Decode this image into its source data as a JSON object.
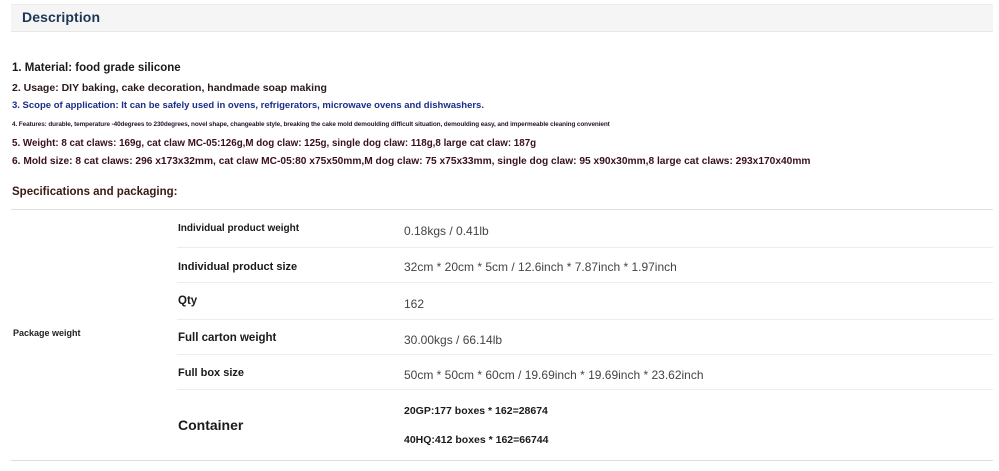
{
  "description": {
    "title": "Description"
  },
  "details": {
    "material": "1. Material: food grade silicone",
    "usage": "2. Usage: DIY baking, cake decoration, handmade soap making",
    "scope": "3. Scope of application: It can be safely used in ovens, refrigerators, microwave ovens and dishwashers.",
    "features": "4. Features: durable, temperature -40degrees to 230degrees, novel shape, changeable style, breaking the cake mold demoulding difficult situation, demoulding easy, and impermeable cleaning convenient",
    "weight": "5. Weight: 8 cat claws: 169g, cat claw MC-05:126g,M dog claw: 125g, single dog claw: 118g,8 large cat claw: 187g",
    "mold_size": "6. Mold size: 8 cat claws: 296 x173x32mm, cat claw MC-05:80 x75x50mm,M dog claw: 75 x75x33mm, single dog claw: 95 x90x30mm,8 large cat claws: 293x170x40mm"
  },
  "specs": {
    "heading": "Specifications and packaging:",
    "group_label": "Package weight",
    "rows": [
      {
        "label": "Individual product weight",
        "value": "0.18kgs / 0.41lb"
      },
      {
        "label": "Individual product size",
        "value": "32cm * 20cm * 5cm / 12.6inch * 7.87inch * 1.97inch"
      },
      {
        "label": "Qty",
        "value": "162"
      },
      {
        "label": "Full carton weight",
        "value": "30.00kgs / 66.14lb"
      },
      {
        "label": "Full box size",
        "value": "50cm * 50cm * 60cm / 19.69inch * 19.69inch * 23.62inch"
      }
    ],
    "container": {
      "label": "Container",
      "line1": "20GP:177 boxes * 162=28674",
      "line2": "40HQ:412 boxes * 162=66744"
    }
  },
  "colors": {
    "title": "#1d3557",
    "header_bg": "#f5f5f5",
    "scope_text": "#1b2d8a"
  }
}
